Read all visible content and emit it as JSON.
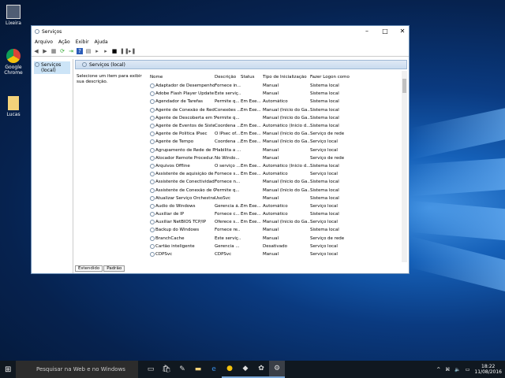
{
  "desktop": {
    "icons": [
      {
        "label": "Lixeira"
      },
      {
        "label": "Google Chrome"
      },
      {
        "label": "Lucas"
      }
    ]
  },
  "window": {
    "title": "Serviços",
    "menu": [
      "Arquivo",
      "Ação",
      "Exibir",
      "Ajuda"
    ],
    "tree_item": "Serviços (local)",
    "band_title": "Serviços (local)",
    "description": "Selecione um item para exibir sua descrição.",
    "columns": [
      "Nome",
      "Descrição",
      "Status",
      "Tipo de Inicialização",
      "Fazer Logon como"
    ],
    "rows": [
      [
        "Adaptador de Desempenho...",
        "Fornece in...",
        "",
        "Manual",
        "Sistema local"
      ],
      [
        "Adobe Flash Player Update ...",
        "Este serviç...",
        "",
        "Manual",
        "Sistema local"
      ],
      [
        "Agendador de Tarefas",
        "Permite q...",
        "Em Exe...",
        "Automático",
        "Sistema local"
      ],
      [
        "Agente de Conexão de Rede",
        "Conexões ...",
        "Em Exe...",
        "Manual (Início do Ga...",
        "Sistema local"
      ],
      [
        "Agente de Descoberta em S...",
        "Permite q...",
        "",
        "Manual (Início do Ga...",
        "Sistema local"
      ],
      [
        "Agente de Eventos de Siste...",
        "Coordena ...",
        "Em Exe...",
        "Automático (Início d...",
        "Sistema local"
      ],
      [
        "Agente de Política IPsec",
        "O IPsec of...",
        "Em Exe...",
        "Manual (Início do Ga...",
        "Serviço de rede"
      ],
      [
        "Agente de Tempo",
        "Coordena ...",
        "Em Exe...",
        "Manual (Início do Ga...",
        "Serviço local"
      ],
      [
        "Agrupamento de Rede de Par",
        "Habilita a ...",
        "",
        "Manual",
        "Serviço local"
      ],
      [
        "Alocador Remote Procedur...",
        "No Windo...",
        "",
        "Manual",
        "Serviço de rede"
      ],
      [
        "Arquivos Offline",
        "O serviço ...",
        "Em Exe...",
        "Automático (Início d...",
        "Sistema local"
      ],
      [
        "Assistente de aquisição de i...",
        "Fornece s...",
        "Em Exe...",
        "Automático",
        "Serviço local"
      ],
      [
        "Assistente de Conectividad...",
        "Fornece n...",
        "",
        "Manual (Início do Ga...",
        "Sistema local"
      ],
      [
        "Assistente de Conexão de C...",
        "Permite q...",
        "",
        "Manual (Início do Ga...",
        "Sistema local"
      ],
      [
        "Atualizar Serviço Orchestrator",
        "UsoSvc",
        "",
        "Manual",
        "Sistema local"
      ],
      [
        "Áudio do Windows",
        "Gerencia á...",
        "Em Exe...",
        "Automático",
        "Serviço local"
      ],
      [
        "Auxiliar de IP",
        "Fornece c...",
        "Em Exe...",
        "Automático",
        "Sistema local"
      ],
      [
        "Auxiliar NetBIOS TCP/IP",
        "Oferece s...",
        "Em Exe...",
        "Manual (Início do Ga...",
        "Serviço local"
      ],
      [
        "Backup do Windows",
        "Fornece re...",
        "",
        "Manual",
        "Sistema local"
      ],
      [
        "BranchCache",
        "Este serviç...",
        "",
        "Manual",
        "Serviço de rede"
      ],
      [
        "Cartão inteligente",
        "Gerencia ...",
        "",
        "Desativado",
        "Serviço local"
      ],
      [
        "CDPSvc",
        "CDPSvc",
        "",
        "Manual",
        "Serviço local"
      ]
    ],
    "tabs": [
      "Estendido",
      "Padrão"
    ]
  },
  "taskbar": {
    "search_placeholder": "Pesquisar na Web e no Windows",
    "time": "18:22",
    "date": "11/08/2016"
  }
}
